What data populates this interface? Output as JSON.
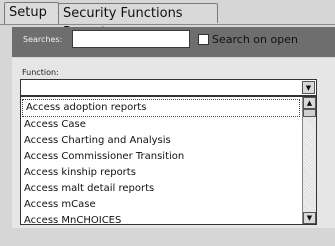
{
  "tabs": [
    {
      "label": "Setup",
      "active": true
    },
    {
      "label": "Security Functions Report",
      "active": false
    }
  ],
  "search": {
    "label": "Searches:",
    "value": "",
    "checkbox_label": "Search on open",
    "checkbox_checked": false
  },
  "function": {
    "label": "Function:",
    "selected": "",
    "options": [
      "Access adoption reports",
      "Access Case",
      "Access Charting and Analysis",
      "Access Commissioner Transition",
      "Access kinship reports",
      "Access malt detail reports",
      "Access mCase",
      "Access MnCHOICES"
    ]
  },
  "colors": {
    "background": "#d6d6d6",
    "search_panel": "#6e6e6e",
    "content_panel": "#e6e6e6"
  },
  "icons": {
    "dropdown": "chevron-down-icon",
    "scroll_up": "chevron-up-icon",
    "scroll_down": "chevron-down-icon"
  }
}
